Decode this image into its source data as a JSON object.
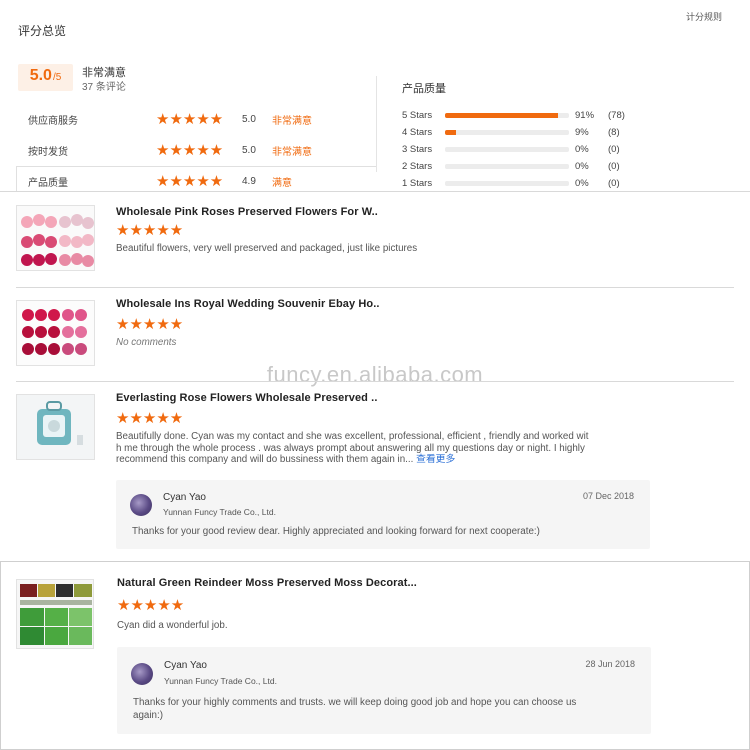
{
  "summary": {
    "title": "评分总览",
    "rules_link": "计分规则",
    "score": "5.0",
    "score_unit": "/5",
    "verdict": "非常满意",
    "review_count": "37 条评论",
    "rows": [
      {
        "label": "供应商服务",
        "stars": "★★★★★",
        "value": "5.0",
        "word": "非常满意"
      },
      {
        "label": "按时发货",
        "stars": "★★★★★",
        "value": "5.0",
        "word": "非常满意"
      },
      {
        "label": "产品质量",
        "stars": "★★★★★",
        "value": "4.9",
        "word": "满意"
      }
    ],
    "bars_title": "产品质量",
    "bars": [
      {
        "label": "5 Stars",
        "fraction": 0.91,
        "percent": "91%",
        "count": "(78)"
      },
      {
        "label": "4 Stars",
        "fraction": 0.09,
        "percent": "9%",
        "count": "(8)"
      },
      {
        "label": "3 Stars",
        "fraction": 0,
        "percent": "0%",
        "count": "(0)"
      },
      {
        "label": "2 Stars",
        "fraction": 0,
        "percent": "0%",
        "count": "(0)"
      },
      {
        "label": "1 Stars",
        "fraction": 0,
        "percent": "0%",
        "count": "(0)"
      }
    ]
  },
  "reviews": [
    {
      "title": "Wholesale Pink Roses Preserved Flowers For W..",
      "stars": "★★★★★",
      "text": "Beautiful flowers, very well preserved and packaged, just like pictures",
      "thumb_icon": "pink-roses-image"
    },
    {
      "title": "Wholesale Ins Royal Wedding Souvenir Ebay Ho..",
      "stars": "★★★★★",
      "text": "No comments",
      "thumb_icon": "red-roses-box-image"
    },
    {
      "title": "Everlasting Rose Flowers Wholesale Preserved ..",
      "stars": "★★★★★",
      "text_lines": [
        "Beautifully done. Cyan was my contact and she was excellent, professional, efficient , friendly and worked wit",
        "h me through the whole process . was always prompt about answering all my questions day or night. I highly",
        "recommend this company and will do bussiness with them again in..."
      ],
      "more": "查看更多",
      "thumb_icon": "teal-rose-box-image",
      "reply": {
        "name": "Cyan Yao",
        "company": "Yunnan Funcy Trade Co., Ltd.",
        "date": "07 Dec 2018",
        "text": "Thanks for your good review dear. Highly appreciated and looking forward for next cooperate:)"
      }
    },
    {
      "title": "Natural Green Reindeer Moss Preserved Moss Decorat...",
      "stars": "★★★★★",
      "text": "Cyan did a wonderful job.",
      "thumb_icon": "moss-image",
      "reply": {
        "name": "Cyan Yao",
        "company": "Yunnan Funcy Trade Co., Ltd.",
        "date": "28 Jun 2018",
        "text_lines": [
          "Thanks for your highly comments and trusts. we will keep doing good job and hope you can choose us",
          "again:)"
        ]
      }
    }
  ],
  "watermark": "funcy.en.alibaba.com",
  "colors": {
    "accent": "#f06a0f",
    "link": "#2a6fd6"
  }
}
